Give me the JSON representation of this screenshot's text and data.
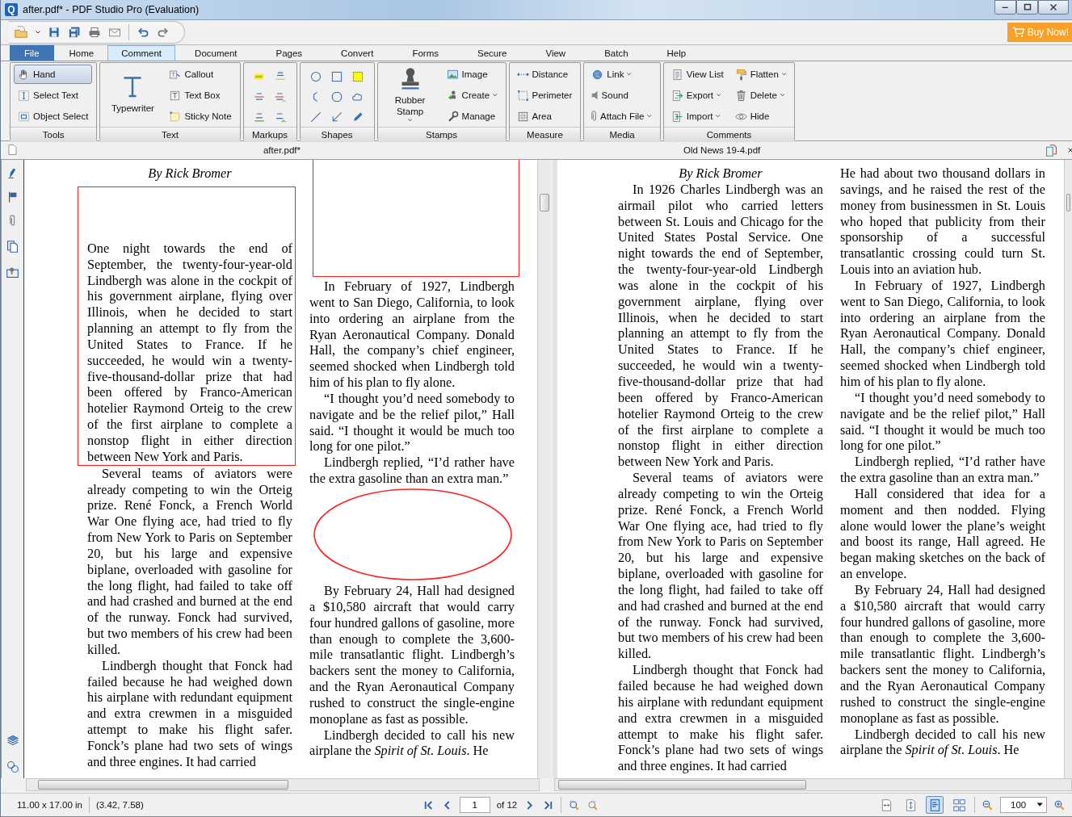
{
  "window": {
    "title": "after.pdf* - PDF Studio Pro (Evaluation)",
    "logo_letter": "Q"
  },
  "quick_toolbar": {
    "buy_button": "Buy Now!"
  },
  "ribbon_tabs": [
    {
      "label": "File",
      "kind": "file",
      "selected": false
    },
    {
      "label": "Home",
      "kind": "tab",
      "selected": false
    },
    {
      "label": "Comment",
      "kind": "tab",
      "selected": true
    },
    {
      "label": "Document",
      "kind": "tab",
      "selected": false
    },
    {
      "label": "Pages",
      "kind": "tab",
      "selected": false
    },
    {
      "label": "Convert",
      "kind": "tab",
      "selected": false
    },
    {
      "label": "Forms",
      "kind": "tab",
      "selected": false
    },
    {
      "label": "Secure",
      "kind": "tab",
      "selected": false
    },
    {
      "label": "View",
      "kind": "tab",
      "selected": false
    },
    {
      "label": "Batch",
      "kind": "tab",
      "selected": false
    },
    {
      "label": "Help",
      "kind": "tab",
      "selected": false
    }
  ],
  "ribbon_groups": [
    {
      "title": "Tools",
      "kind": "buttons",
      "columns": [
        [
          {
            "label": "Hand",
            "dropdown": false,
            "selected": true
          },
          {
            "label": "Select Text",
            "dropdown": false,
            "selected": false
          },
          {
            "label": "Object Select",
            "dropdown": false,
            "selected": false
          }
        ]
      ]
    },
    {
      "title": "Text",
      "kind": "buttons",
      "large": {
        "label": "Typewriter",
        "dropdown": false
      },
      "columns": [
        [
          {
            "label": "Callout",
            "dropdown": false
          },
          {
            "label": "Text Box",
            "dropdown": false
          },
          {
            "label": "Sticky Note",
            "dropdown": false
          }
        ]
      ]
    },
    {
      "title": "Markups",
      "kind": "icons"
    },
    {
      "title": "Shapes",
      "kind": "icons"
    },
    {
      "title": "Stamps",
      "kind": "buttons",
      "large": {
        "label": "Rubber Stamp",
        "dropdown": true
      },
      "columns": [
        [
          {
            "label": "Image",
            "dropdown": false
          },
          {
            "label": "Create",
            "dropdown": true
          },
          {
            "label": "Manage",
            "dropdown": false
          }
        ]
      ]
    },
    {
      "title": "Measure",
      "kind": "buttons",
      "columns": [
        [
          {
            "label": "Distance",
            "dropdown": false
          },
          {
            "label": "Perimeter",
            "dropdown": false
          },
          {
            "label": "Area",
            "dropdown": false
          }
        ]
      ]
    },
    {
      "title": "Media",
      "kind": "buttons",
      "columns": [
        [
          {
            "label": "Link",
            "dropdown": true
          },
          {
            "label": "Sound",
            "dropdown": false
          },
          {
            "label": "Attach File",
            "dropdown": true
          }
        ]
      ]
    },
    {
      "title": "Comments",
      "kind": "buttons",
      "columns": [
        [
          {
            "label": "View List",
            "dropdown": false
          },
          {
            "label": "Export",
            "dropdown": true
          },
          {
            "label": "Import",
            "dropdown": true
          }
        ],
        [
          {
            "label": "Flatten",
            "dropdown": true
          },
          {
            "label": "Delete",
            "dropdown": true
          },
          {
            "label": "Hide",
            "dropdown": false
          }
        ]
      ]
    }
  ],
  "documents": [
    {
      "tab_title": "after.pdf*",
      "columns": [
        [
          {
            "kind": "title",
            "text": "By Rick Bromer"
          },
          {
            "kind": "rectangle",
            "paragraphs": [
              {
                "text": "One night towards the end of September, the twenty-four-year-old Lindbergh was alone in the cockpit of his government airplane, flying over Illinois, when he decided to start planning an attempt to fly from the United States to France. If he succeeded, he would win a twenty-five-thousand-dollar prize that had been offered by Franco-American hotelier Raymond Orteig to the crew of the first airplane to complete a nonstop flight in either direction between New York and Paris.",
                "indent": false
              }
            ]
          },
          {
            "kind": "paragraph",
            "text": "Several teams of aviators were already competing to win the Orteig prize. René Fonck, a French World War One flying ace, had tried to fly from New York to Paris on September 20, but his large and expensive biplane, overloaded with gasoline for the long flight, had failed to take off and had crashed and burned at the end of the runway. Fonck had survived, but two members of his crew had been killed.",
            "indent": true
          },
          {
            "kind": "paragraph",
            "text": "Lindbergh thought that Fonck had failed because he had weighed down his airplane with redundant equipment and extra crewmen in a misguided attempt to make his flight safer. Fonck’s plane had two sets of wings and three engines. It had carried",
            "indent": true
          }
        ],
        [
          {
            "kind": "rectangle"
          },
          {
            "kind": "paragraph",
            "text": "In February of 1927, Lindbergh went to San Diego, California, to look into ordering an airplane from the Ryan Aeronautical Company. Donald Hall, the company’s chief engineer, seemed shocked when Lindbergh told him of his plan to fly alone.",
            "indent": true
          },
          {
            "kind": "paragraph",
            "text": "“I thought you’d need somebody to navigate and be the relief pilot,” Hall said. “I thought it would be much too long for one pilot.”",
            "indent": true
          },
          {
            "kind": "paragraph",
            "text": "Lindbergh replied, “I’d rather have the extra gasoline than an extra man.”",
            "indent": true
          },
          {
            "kind": "ellipse"
          },
          {
            "kind": "paragraph",
            "text": "By February 24, Hall had designed a $10,580 aircraft that would carry four hundred gallons of gasoline, more than enough to complete the 3,600-mile transatlantic flight. Lindbergh’s backers sent the money to California, and the Ryan Aeronautical Company rushed to construct the single-engine monoplane as fast as possible.",
            "indent": true
          },
          {
            "kind": "paragraph",
            "text": "Lindbergh decided to call his new airplane the *Spirit of St. Louis*. He",
            "indent": true
          }
        ]
      ]
    },
    {
      "tab_title": "Old News 19-4.pdf",
      "columns": [
        [
          {
            "kind": "title",
            "text": "By Rick Bromer"
          },
          {
            "kind": "paragraph",
            "text": "In 1926 Charles Lindbergh was an airmail pilot who carried letters between St. Louis and Chicago for the United States Postal Service. One night towards the end of September, the twenty-four-year-old Lindbergh was alone in the cockpit of his government airplane, flying over Illinois, when he decided to start planning an attempt to fly from the United States to France. If he succeeded, he would win a twenty-five-thousand-dollar prize that had been offered by Franco-American hotelier Raymond Orteig to the crew of the first airplane to complete a nonstop flight in either direction between New York and Paris.",
            "indent": true
          },
          {
            "kind": "paragraph",
            "text": "Several teams of aviators were already competing to win the Orteig prize. René Fonck, a French World War One flying ace, had tried to fly from New York to Paris on September 20, but his large and expensive biplane, overloaded with gasoline for the long flight, had failed to take off and had crashed and burned at the end of the runway. Fonck had survived, but two members of his crew had been killed.",
            "indent": true
          },
          {
            "kind": "paragraph",
            "text": "Lindbergh thought that Fonck had failed because he had weighed down his airplane with redundant equipment and extra crewmen in a misguided attempt to make his flight safer. Fonck’s plane had two sets of wings and three engines. It had carried",
            "indent": true
          }
        ],
        [
          {
            "kind": "paragraph",
            "text": "He had about two thousand dollars in savings, and he raised the rest of the money from businessmen in St. Louis who hoped that publicity from their sponsorship of a successful transatlantic crossing could turn St. Louis into an aviation hub.",
            "indent": false
          },
          {
            "kind": "paragraph",
            "text": "In February of 1927, Lindbergh went to San Diego, California, to look into ordering an airplane from the Ryan Aeronautical Company. Donald Hall, the company’s chief engineer, seemed shocked when Lindbergh told him of his plan to fly alone.",
            "indent": true
          },
          {
            "kind": "paragraph",
            "text": "“I thought you’d need somebody to navigate and be the relief pilot,” Hall said. “I thought it would be much too long for one pilot.”",
            "indent": true
          },
          {
            "kind": "paragraph",
            "text": "Lindbergh replied, “I’d rather have the extra gasoline than an extra man.”",
            "indent": true
          },
          {
            "kind": "paragraph",
            "text": "Hall considered that idea for a moment and then nodded. Flying alone would lower the plane’s weight and boost its range, Hall agreed. He began making sketches on the back of an envelope.",
            "indent": true
          },
          {
            "kind": "paragraph",
            "text": "By February 24, Hall had designed a $10,580 aircraft that would carry four hundred gallons of gasoline, more than enough to complete the 3,600-mile transatlantic flight. Lindbergh’s backers sent the money to California, and the Ryan Aeronautical Company rushed to construct the single-engine monoplane as fast as possible.",
            "indent": true
          },
          {
            "kind": "paragraph",
            "text": "Lindbergh decided to call his new airplane the *Spirit of St. Louis*. He",
            "indent": true
          }
        ]
      ]
    }
  ],
  "status_bar": {
    "page_size": "11.00 x 17.00 in",
    "cursor": "(3.42, 7.58)",
    "page_input": "1",
    "page_count": "of 12",
    "zoom": "100",
    "view_modes": [
      {
        "selected": false
      },
      {
        "selected": false
      },
      {
        "selected": true
      },
      {
        "selected": false
      }
    ]
  }
}
